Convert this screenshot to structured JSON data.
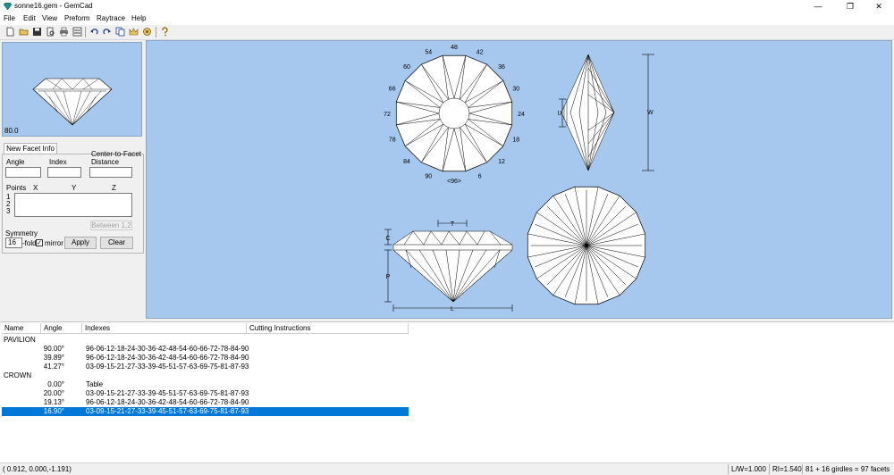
{
  "window": {
    "title": "sonne16.gem - GemCad"
  },
  "menu": [
    "File",
    "Edit",
    "View",
    "Preform",
    "Raytrace",
    "Help"
  ],
  "toolbar": {
    "icons": [
      "new-icon",
      "open-icon",
      "save-icon",
      "print-preview-icon",
      "print-icon",
      "properties-icon",
      "undo-icon",
      "redo-icon",
      "copy-icon",
      "crown-icon",
      "gem-icon",
      "help-icon"
    ]
  },
  "preview": {
    "zoom": "80.0"
  },
  "facet_panel": {
    "tab": "New Facet Info",
    "angle_label": "Angle",
    "index_label": "Index",
    "ctf_label_1": "Center-to-Facet",
    "ctf_label_2": "Distance",
    "points_label": "Points",
    "x_label": "X",
    "y_label": "Y",
    "z_label": "Z",
    "point_rows": [
      "1",
      "2",
      "3"
    ],
    "between_button": "Between 1,2",
    "symmetry_label": "Symmetry",
    "symmetry_value": "16",
    "fold_label": "-fold",
    "mirror_label": "mirror",
    "mirror_checked": true,
    "apply_button": "Apply",
    "clear_button": "Clear"
  },
  "views": {
    "top_indices": [
      "48",
      "42",
      "36",
      "30",
      "24",
      "18",
      "12",
      "6",
      "<96>",
      "90",
      "84",
      "78",
      "72",
      "66",
      "60",
      "54"
    ],
    "side_labels": {
      "u": "U",
      "w": "W",
      "t": "T",
      "c": "C",
      "p": "P",
      "l": "L"
    }
  },
  "table": {
    "headers": [
      "Name",
      "Angle",
      "Indexes",
      "Cutting Instructions"
    ],
    "rows": [
      {
        "name": "PAVILION",
        "angle": "",
        "indexes": "",
        "instructions": ""
      },
      {
        "name": "",
        "angle": "90.00°",
        "indexes": "96-06-12-18-24-30-36-42-48-54-60-66-72-78-84-90",
        "instructions": ""
      },
      {
        "name": "",
        "angle": "39.89°",
        "indexes": "96-06-12-18-24-30-36-42-48-54-60-66-72-78-84-90",
        "instructions": ""
      },
      {
        "name": "",
        "angle": "41.27°",
        "indexes": "03-09-15-21-27-33-39-45-51-57-63-69-75-81-87-93",
        "instructions": ""
      },
      {
        "name": "CROWN",
        "angle": "",
        "indexes": "",
        "instructions": ""
      },
      {
        "name": "",
        "angle": "0.00°",
        "indexes": "Table",
        "instructions": ""
      },
      {
        "name": "",
        "angle": "20.00°",
        "indexes": "03-09-15-21-27-33-39-45-51-57-63-69-75-81-87-93",
        "instructions": ""
      },
      {
        "name": "",
        "angle": "19.13°",
        "indexes": "96-06-12-18-24-30-36-42-48-54-60-66-72-78-84-90",
        "instructions": ""
      },
      {
        "name": "",
        "angle": "16.90°",
        "indexes": "03-09-15-21-27-33-39-45-51-57-63-69-75-81-87-93",
        "instructions": "",
        "selected": true
      }
    ]
  },
  "status": {
    "coords": "( 0.912, 0.000,-1.191)",
    "lw": "L/W=1.000",
    "ri": "RI=1.540",
    "facets": "81 + 16 girdles = 97 facets"
  }
}
